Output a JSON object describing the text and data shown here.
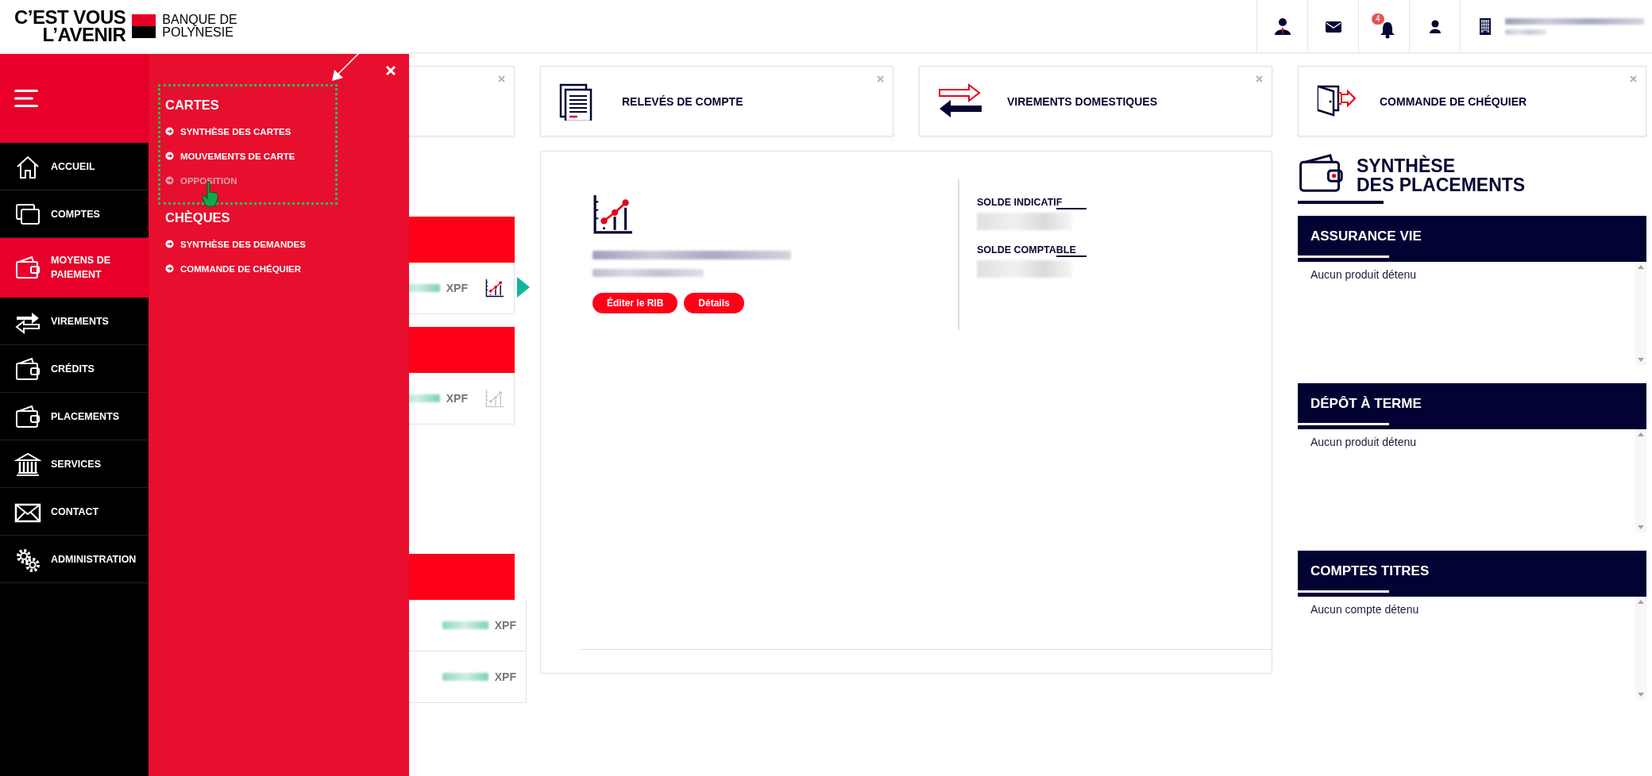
{
  "header": {
    "logo_lines": [
      "C’EST VOUS",
      "L’AVENIR"
    ],
    "brand_lines": [
      "BANQUE DE",
      "POLYNESIE"
    ],
    "tools": [
      {
        "kind": "advisor"
      },
      {
        "kind": "mail"
      },
      {
        "kind": "bell",
        "badge": "4"
      },
      {
        "kind": "user"
      },
      {
        "kind": "building"
      }
    ]
  },
  "sidebar": {
    "items": [
      {
        "label": "ACCUEIL",
        "kind": "home",
        "selected": false
      },
      {
        "label": "COMPTES",
        "kind": "accounts",
        "selected": false
      },
      {
        "label": "MOYENS DE PAIEMENT",
        "kind": "wallet",
        "selected": true
      },
      {
        "label": "VIREMENTS",
        "kind": "transfer",
        "selected": false
      },
      {
        "label": "CRÉDITS",
        "kind": "wallet",
        "selected": false
      },
      {
        "label": "PLACEMENTS",
        "kind": "wallet",
        "selected": false
      },
      {
        "label": "SERVICES",
        "kind": "bank",
        "selected": false
      },
      {
        "label": "CONTACT",
        "kind": "mail",
        "selected": false
      },
      {
        "label": "ADMINISTRATION",
        "kind": "gear",
        "selected": false
      }
    ]
  },
  "submenu": {
    "groups": [
      {
        "title": "CARTES",
        "highlighted": true,
        "items": [
          {
            "label": "SYNTHÈSE DES CARTES",
            "hovered": false
          },
          {
            "label": "MOUVEMENTS DE CARTE",
            "hovered": false
          },
          {
            "label": "OPPOSITION",
            "hovered": true
          }
        ]
      },
      {
        "title": "CHÈQUES",
        "highlighted": false,
        "items": [
          {
            "label": "SYNTHÈSE DES DEMANDES",
            "hovered": false
          },
          {
            "label": "COMMANDE DE CHÉQUIER",
            "hovered": false
          }
        ]
      }
    ]
  },
  "shortcuts": [
    {
      "label": "RELEVÉS DE COMPTE",
      "kind": "document"
    },
    {
      "label": "VIREMENTS DOMESTIQUES",
      "kind": "transfer"
    },
    {
      "label": "COMMANDE DE CHÉQUIER",
      "kind": "checkbook"
    }
  ],
  "accounts_summary": {
    "groups": [
      {
        "rows": [
          {
            "currency": "XPF",
            "selected": true
          }
        ]
      },
      {
        "rows": [
          {
            "currency": "XPF",
            "selected": false
          }
        ]
      }
    ]
  },
  "credits_summary": {
    "groups": [
      {
        "rows": [
          {
            "currency": "XPF"
          },
          {
            "currency": "XPF"
          }
        ]
      }
    ]
  },
  "account_detail": {
    "buttons": [
      "Éditer le RIB",
      "Détails"
    ],
    "balances": [
      {
        "label": "SOLDE INDICATIF"
      },
      {
        "label": "SOLDE COMPTABLE"
      }
    ]
  },
  "placements": {
    "title_lines": [
      "SYNTHÈSE",
      "DES PLACEMENTS"
    ],
    "sections": [
      {
        "title": "ASSURANCE VIE",
        "empty_text": "Aucun produit détenu"
      },
      {
        "title": "DÉPÔT À TERME",
        "empty_text": "Aucun produit détenu"
      },
      {
        "title": "COMPTES TITRES",
        "empty_text": "Aucun compte détenu"
      }
    ]
  }
}
